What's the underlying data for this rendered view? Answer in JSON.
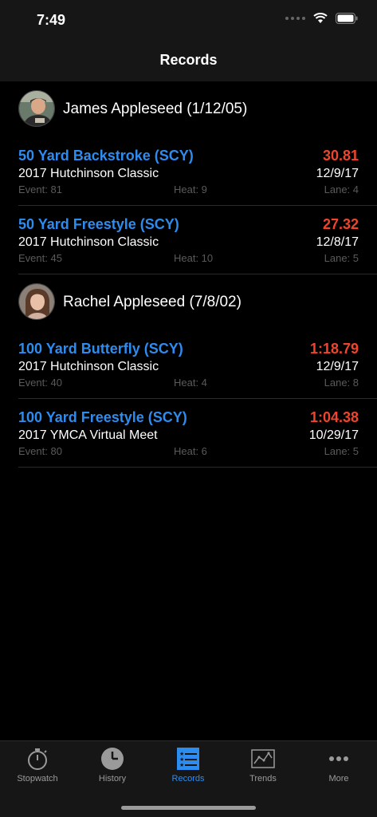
{
  "status": {
    "time": "7:49"
  },
  "nav": {
    "title": "Records"
  },
  "swimmers": [
    {
      "name": "James Appleseed (1/12/05)",
      "records": [
        {
          "event": "50 Yard Backstroke (SCY)",
          "time": "30.81",
          "meet": "2017 Hutchinson Classic",
          "date": "12/9/17",
          "event_num": "Event: 81",
          "heat": "Heat: 9",
          "lane": "Lane: 4"
        },
        {
          "event": "50 Yard Freestyle (SCY)",
          "time": "27.32",
          "meet": "2017 Hutchinson Classic",
          "date": "12/8/17",
          "event_num": "Event: 45",
          "heat": "Heat: 10",
          "lane": "Lane: 5"
        }
      ]
    },
    {
      "name": "Rachel Appleseed (7/8/02)",
      "records": [
        {
          "event": "100 Yard Butterfly (SCY)",
          "time": "1:18.79",
          "meet": "2017 Hutchinson Classic",
          "date": "12/9/17",
          "event_num": "Event: 40",
          "heat": "Heat: 4",
          "lane": "Lane: 8"
        },
        {
          "event": "100 Yard Freestyle (SCY)",
          "time": "1:04.38",
          "meet": "2017 YMCA Virtual Meet",
          "date": "10/29/17",
          "event_num": "Event: 80",
          "heat": "Heat: 6",
          "lane": "Lane: 5"
        }
      ]
    }
  ],
  "tabs": [
    {
      "label": "Stopwatch",
      "icon": "stopwatch-icon",
      "active": false
    },
    {
      "label": "History",
      "icon": "clock-icon",
      "active": false
    },
    {
      "label": "Records",
      "icon": "list-icon",
      "active": true
    },
    {
      "label": "Trends",
      "icon": "chart-icon",
      "active": false
    },
    {
      "label": "More",
      "icon": "ellipsis-icon",
      "active": false
    }
  ],
  "colors": {
    "accent": "#2d8cf0",
    "time": "#f0442c",
    "background": "#000000",
    "bar": "#161616"
  }
}
